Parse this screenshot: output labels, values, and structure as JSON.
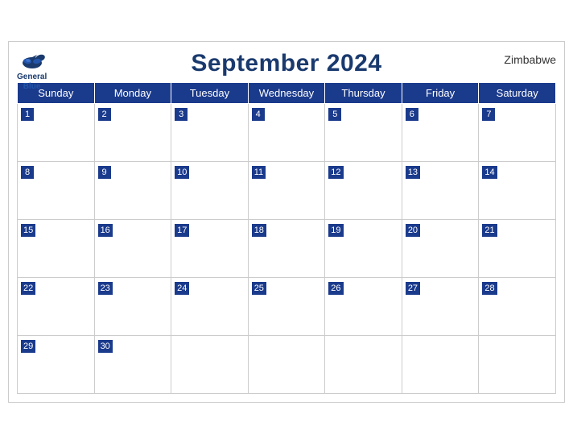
{
  "calendar": {
    "title": "September 2024",
    "country": "Zimbabwe",
    "days_of_week": [
      "Sunday",
      "Monday",
      "Tuesday",
      "Wednesday",
      "Thursday",
      "Friday",
      "Saturday"
    ],
    "weeks": [
      [
        {
          "day": 1,
          "empty": false
        },
        {
          "day": 2,
          "empty": false
        },
        {
          "day": 3,
          "empty": false
        },
        {
          "day": 4,
          "empty": false
        },
        {
          "day": 5,
          "empty": false
        },
        {
          "day": 6,
          "empty": false
        },
        {
          "day": 7,
          "empty": false
        }
      ],
      [
        {
          "day": 8,
          "empty": false
        },
        {
          "day": 9,
          "empty": false
        },
        {
          "day": 10,
          "empty": false
        },
        {
          "day": 11,
          "empty": false
        },
        {
          "day": 12,
          "empty": false
        },
        {
          "day": 13,
          "empty": false
        },
        {
          "day": 14,
          "empty": false
        }
      ],
      [
        {
          "day": 15,
          "empty": false
        },
        {
          "day": 16,
          "empty": false
        },
        {
          "day": 17,
          "empty": false
        },
        {
          "day": 18,
          "empty": false
        },
        {
          "day": 19,
          "empty": false
        },
        {
          "day": 20,
          "empty": false
        },
        {
          "day": 21,
          "empty": false
        }
      ],
      [
        {
          "day": 22,
          "empty": false
        },
        {
          "day": 23,
          "empty": false
        },
        {
          "day": 24,
          "empty": false
        },
        {
          "day": 25,
          "empty": false
        },
        {
          "day": 26,
          "empty": false
        },
        {
          "day": 27,
          "empty": false
        },
        {
          "day": 28,
          "empty": false
        }
      ],
      [
        {
          "day": 29,
          "empty": false
        },
        {
          "day": 30,
          "empty": false
        },
        {
          "day": null,
          "empty": true
        },
        {
          "day": null,
          "empty": true
        },
        {
          "day": null,
          "empty": true
        },
        {
          "day": null,
          "empty": true
        },
        {
          "day": null,
          "empty": true
        }
      ]
    ],
    "logo": {
      "general": "General",
      "blue": "Blue"
    }
  }
}
